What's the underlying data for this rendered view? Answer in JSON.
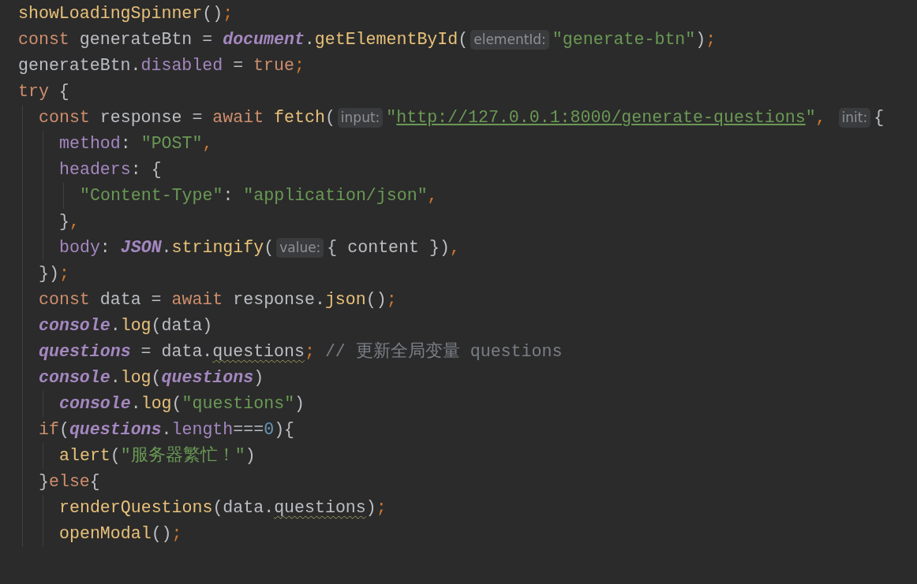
{
  "lines": [
    {
      "tokens": [
        {
          "kind": "call",
          "text": "showLoadingSpinner"
        },
        {
          "kind": "punct",
          "text": "()"
        },
        {
          "kind": "semi",
          "text": ";"
        }
      ]
    },
    {
      "tokens": [
        {
          "kind": "keyword",
          "text": "const "
        },
        {
          "kind": "ident",
          "text": "generateBtn = "
        },
        {
          "kind": "global",
          "text": "document"
        },
        {
          "kind": "ident",
          "text": "."
        },
        {
          "kind": "call",
          "text": "getElementById"
        },
        {
          "kind": "punct",
          "text": "("
        },
        {
          "kind": "hint",
          "text": "elementId:"
        },
        {
          "kind": "string",
          "text": "\"generate-btn\""
        },
        {
          "kind": "punct",
          "text": ")"
        },
        {
          "kind": "semi",
          "text": ";"
        }
      ]
    },
    {
      "tokens": [
        {
          "kind": "ident",
          "text": "generateBtn."
        },
        {
          "kind": "prop",
          "text": "disabled"
        },
        {
          "kind": "ident",
          "text": " = "
        },
        {
          "kind": "keyword",
          "text": "true"
        },
        {
          "kind": "semi",
          "text": ";"
        }
      ]
    },
    {
      "tokens": [
        {
          "kind": "keyword",
          "text": "try "
        },
        {
          "kind": "punct",
          "text": "{"
        }
      ],
      "children": [
        {
          "tokens": [
            {
              "kind": "keyword",
              "text": "const "
            },
            {
              "kind": "ident",
              "text": "response = "
            },
            {
              "kind": "keyword",
              "text": "await "
            },
            {
              "kind": "call",
              "text": "fetch"
            },
            {
              "kind": "punct",
              "text": "("
            },
            {
              "kind": "hint",
              "text": "input:"
            },
            {
              "kind": "string",
              "text": "\""
            },
            {
              "kind": "url",
              "text": "http://127.0.0.1:8000/generate-questions"
            },
            {
              "kind": "string",
              "text": "\""
            },
            {
              "kind": "semi",
              "text": ", "
            },
            {
              "kind": "hint",
              "text": "init:"
            },
            {
              "kind": "punct",
              "text": "{"
            }
          ],
          "children": [
            {
              "tokens": [
                {
                  "kind": "prop",
                  "text": "method"
                },
                {
                  "kind": "ident",
                  "text": ": "
                },
                {
                  "kind": "string",
                  "text": "\"POST\""
                },
                {
                  "kind": "semi",
                  "text": ","
                }
              ]
            },
            {
              "tokens": [
                {
                  "kind": "prop",
                  "text": "headers"
                },
                {
                  "kind": "ident",
                  "text": ": {"
                }
              ],
              "children": [
                {
                  "tokens": [
                    {
                      "kind": "string",
                      "text": "\"Content-Type\""
                    },
                    {
                      "kind": "ident",
                      "text": ": "
                    },
                    {
                      "kind": "string",
                      "text": "\"application/json\""
                    },
                    {
                      "kind": "semi",
                      "text": ","
                    }
                  ]
                }
              ]
            },
            {
              "tokens": [
                {
                  "kind": "punct",
                  "text": "}"
                },
                {
                  "kind": "semi",
                  "text": ","
                }
              ]
            },
            {
              "tokens": [
                {
                  "kind": "prop",
                  "text": "body"
                },
                {
                  "kind": "ident",
                  "text": ": "
                },
                {
                  "kind": "global",
                  "text": "JSON"
                },
                {
                  "kind": "ident",
                  "text": "."
                },
                {
                  "kind": "call",
                  "text": "stringify"
                },
                {
                  "kind": "punct",
                  "text": "("
                },
                {
                  "kind": "hint",
                  "text": "value:"
                },
                {
                  "kind": "ident",
                  "text": "{ content })"
                },
                {
                  "kind": "semi",
                  "text": ","
                }
              ]
            }
          ]
        },
        {
          "tokens": [
            {
              "kind": "punct",
              "text": "})"
            },
            {
              "kind": "semi",
              "text": ";"
            }
          ]
        },
        {
          "tokens": [
            {
              "kind": "keyword",
              "text": "const "
            },
            {
              "kind": "ident",
              "text": "data = "
            },
            {
              "kind": "keyword",
              "text": "await "
            },
            {
              "kind": "ident",
              "text": "response."
            },
            {
              "kind": "call",
              "text": "json"
            },
            {
              "kind": "punct",
              "text": "()"
            },
            {
              "kind": "semi",
              "text": ";"
            }
          ]
        },
        {
          "tokens": [
            {
              "kind": "global",
              "text": "console"
            },
            {
              "kind": "ident",
              "text": "."
            },
            {
              "kind": "call",
              "text": "log"
            },
            {
              "kind": "punct",
              "text": "(data)"
            }
          ]
        },
        {
          "tokens": [
            {
              "kind": "global",
              "text": "questions"
            },
            {
              "kind": "ident",
              "text": " = data."
            },
            {
              "kind": "flagged",
              "text": "questions"
            },
            {
              "kind": "semi",
              "text": ";"
            },
            {
              "kind": "comment",
              "text": " // 更新全局变量 questions"
            }
          ]
        },
        {
          "tokens": [
            {
              "kind": "global",
              "text": "console"
            },
            {
              "kind": "ident",
              "text": "."
            },
            {
              "kind": "call",
              "text": "log"
            },
            {
              "kind": "punct",
              "text": "("
            },
            {
              "kind": "global",
              "text": "questions"
            },
            {
              "kind": "punct",
              "text": ")"
            }
          ],
          "children": [
            {
              "tokens": [
                {
                  "kind": "global",
                  "text": "console"
                },
                {
                  "kind": "ident",
                  "text": "."
                },
                {
                  "kind": "call",
                  "text": "log"
                },
                {
                  "kind": "punct",
                  "text": "("
                },
                {
                  "kind": "string",
                  "text": "\"questions\""
                },
                {
                  "kind": "punct",
                  "text": ")"
                }
              ]
            }
          ]
        },
        {
          "tokens": [
            {
              "kind": "keyword",
              "text": "if"
            },
            {
              "kind": "punct",
              "text": "("
            },
            {
              "kind": "global",
              "text": "questions"
            },
            {
              "kind": "ident",
              "text": "."
            },
            {
              "kind": "prop",
              "text": "length"
            },
            {
              "kind": "ident",
              "text": "==="
            },
            {
              "kind": "number",
              "text": "0"
            },
            {
              "kind": "punct",
              "text": "){"
            }
          ],
          "children": [
            {
              "tokens": [
                {
                  "kind": "call",
                  "text": "alert"
                },
                {
                  "kind": "punct",
                  "text": "("
                },
                {
                  "kind": "string",
                  "text": "\"服务器繁忙！\""
                },
                {
                  "kind": "punct",
                  "text": ")"
                }
              ]
            }
          ]
        },
        {
          "tokens": [
            {
              "kind": "punct",
              "text": "}"
            },
            {
              "kind": "keyword",
              "text": "else"
            },
            {
              "kind": "punct",
              "text": "{"
            }
          ],
          "children": [
            {
              "tokens": [
                {
                  "kind": "call",
                  "text": "renderQuestions"
                },
                {
                  "kind": "punct",
                  "text": "(data."
                },
                {
                  "kind": "flagged",
                  "text": "questions"
                },
                {
                  "kind": "punct",
                  "text": ")"
                },
                {
                  "kind": "semi",
                  "text": ";"
                }
              ]
            },
            {
              "tokens": [
                {
                  "kind": "call",
                  "text": "openModal"
                },
                {
                  "kind": "punct",
                  "text": "()"
                },
                {
                  "kind": "semi",
                  "text": ";"
                }
              ]
            }
          ]
        }
      ]
    }
  ]
}
